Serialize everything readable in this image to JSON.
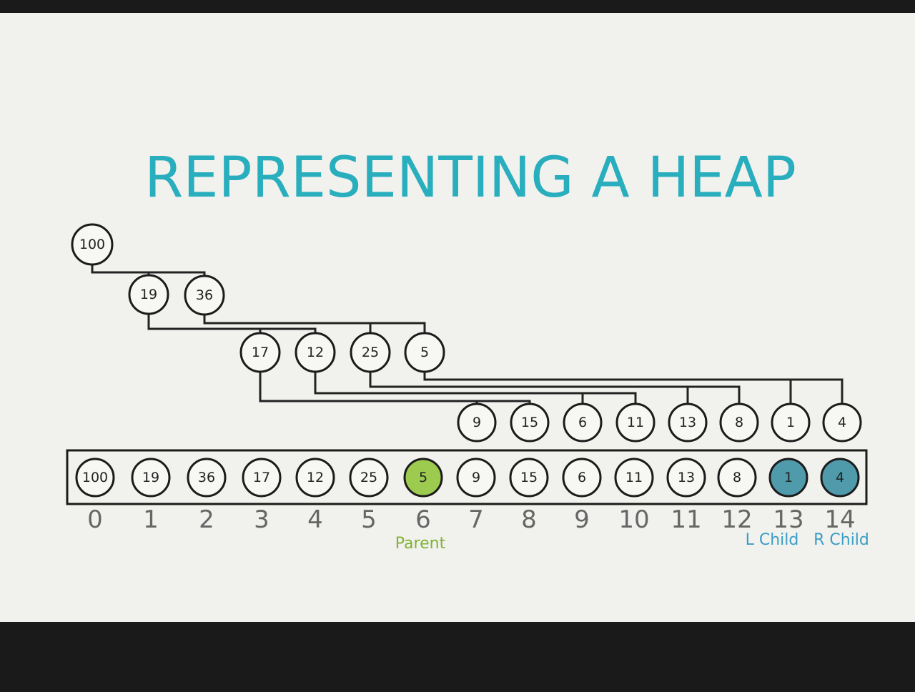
{
  "slide": {
    "title": "REPRESENTING A HEAP"
  },
  "heap": {
    "values": [
      "100",
      "19",
      "36",
      "17",
      "12",
      "25",
      "5",
      "9",
      "15",
      "6",
      "11",
      "13",
      "8",
      "1",
      "4"
    ]
  },
  "array": {
    "indices": [
      "0",
      "1",
      "2",
      "3",
      "4",
      "5",
      "6",
      "7",
      "8",
      "9",
      "10",
      "11",
      "12",
      "13",
      "14"
    ],
    "highlight_parent_index": 6,
    "highlight_children_indices": [
      13,
      14
    ]
  },
  "labels": {
    "parent": "Parent",
    "left_child": "L Child",
    "right_child": "R Child"
  },
  "colors": {
    "title": "#29aebe",
    "parent_fill": "#9ccb4f",
    "parent_label": "#7fb231",
    "child_fill": "#4f9aab",
    "child_label": "#3a9ec4"
  }
}
